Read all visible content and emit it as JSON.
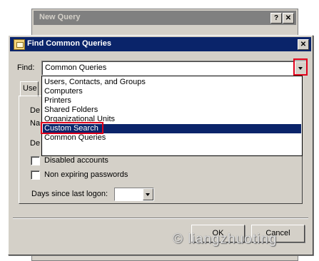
{
  "background_window": {
    "title": "New Query",
    "help_button": "?",
    "close_button": "✕"
  },
  "dialog": {
    "title": "Find Common Queries",
    "close_button": "✕",
    "find_label": "Find:",
    "find_value": "Common Queries",
    "tab_label_partial": "Use",
    "field_label_fragments": [
      "De",
      "Na",
      "De"
    ],
    "dropdown_items": [
      "Users, Contacts, and Groups",
      "Computers",
      "Printers",
      "Shared Folders",
      "Organizational Units",
      "Custom Search",
      "Common Queries"
    ],
    "selected_item": "Custom Search",
    "checkboxes": [
      {
        "label": "Disabled accounts",
        "checked": false
      },
      {
        "label": "Non expiring passwords",
        "checked": false
      }
    ],
    "days_label": "Days since last logon:",
    "days_value": "",
    "ok_button": "OK",
    "cancel_button": "Cancel"
  },
  "watermark": "© liangzhuoting",
  "colors": {
    "titlebar_active": "#0a246a",
    "highlight_box": "#e0001b",
    "face": "#d4d0c8"
  }
}
